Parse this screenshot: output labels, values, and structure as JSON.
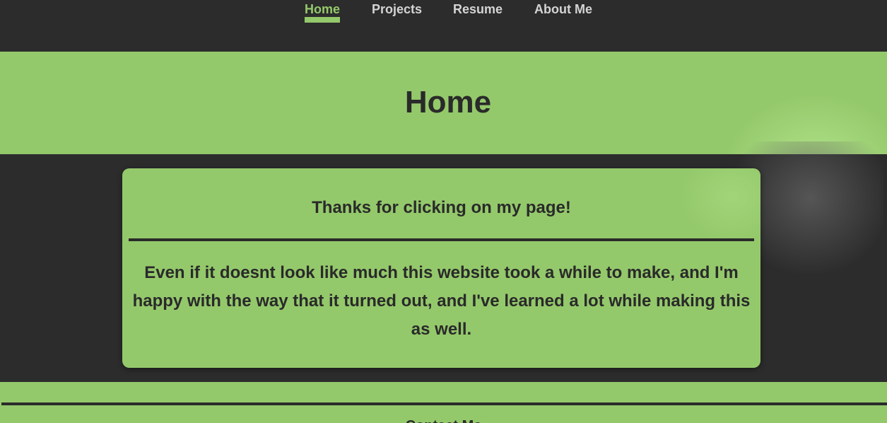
{
  "nav": {
    "items": [
      {
        "label": "Home",
        "active": true
      },
      {
        "label": "Projects",
        "active": false
      },
      {
        "label": "Resume",
        "active": false
      },
      {
        "label": "About Me",
        "active": false
      }
    ]
  },
  "hero": {
    "title": "Home"
  },
  "card": {
    "heading": "Thanks for clicking on my page!",
    "body": "Even if it doesnt look like much this website took a while to make, and I'm happy with the way that it turned out, and I've learned a lot while making this as well."
  },
  "footer": {
    "heading": "Contact Me"
  },
  "colors": {
    "accent": "#94c96b",
    "background": "#2c2c2c",
    "text_dark": "#2a2a2a",
    "nav_text": "#d4d4d4"
  }
}
